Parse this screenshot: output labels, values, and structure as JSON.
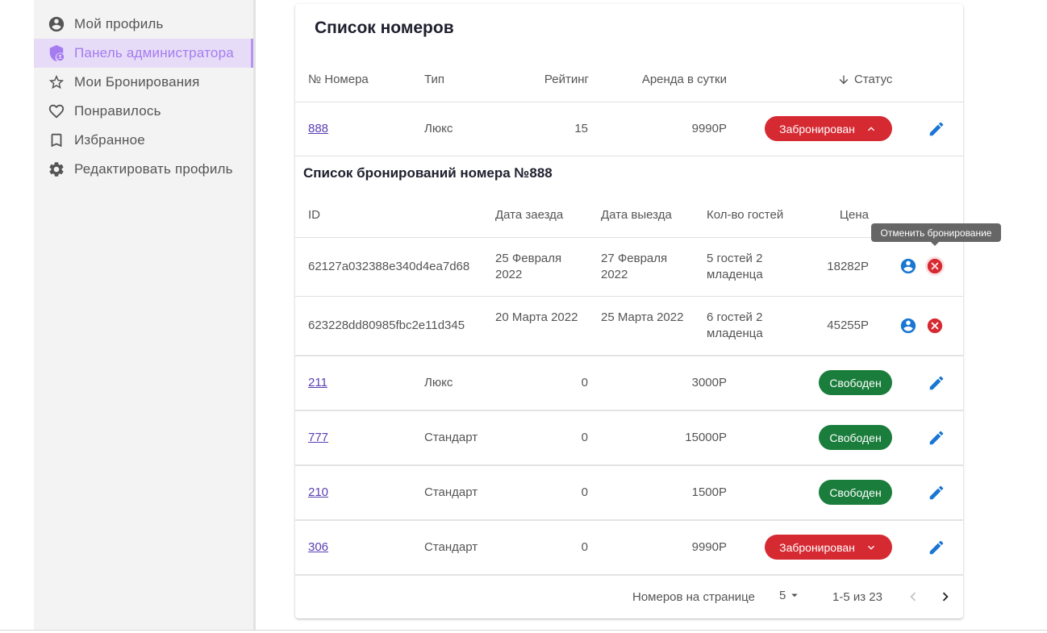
{
  "sidebar": {
    "items": [
      {
        "label": "Мой профиль",
        "icon": "account-circle-icon"
      },
      {
        "label": "Панель администратора",
        "icon": "admin-shield-icon",
        "active": true
      },
      {
        "label": "Мои Бронирования",
        "icon": "star-outline-icon"
      },
      {
        "label": "Понравилось",
        "icon": "heart-outline-icon"
      },
      {
        "label": "Избранное",
        "icon": "bookmark-outline-icon"
      },
      {
        "label": "Редактировать профиль",
        "icon": "gear-icon"
      }
    ]
  },
  "main": {
    "title": "Список номеров",
    "columns": {
      "number": "№ Номера",
      "type": "Тип",
      "rating": "Рейтинг",
      "rent": "Аренда в сутки",
      "status": "Статус"
    },
    "rows": [
      {
        "number": "888",
        "type": "Люкс",
        "rating": "15",
        "rent": "9990Р",
        "status": "Забронирован",
        "expanded": true
      },
      {
        "number": "211",
        "type": "Люкс",
        "rating": "0",
        "rent": "3000Р",
        "status": "Свободен"
      },
      {
        "number": "777",
        "type": "Стандарт",
        "rating": "0",
        "rent": "15000Р",
        "status": "Свободен"
      },
      {
        "number": "210",
        "type": "Стандарт",
        "rating": "0",
        "rent": "1500Р",
        "status": "Свободен"
      },
      {
        "number": "306",
        "type": "Стандарт",
        "rating": "0",
        "rent": "9990Р",
        "status": "Забронирован"
      }
    ],
    "bookings": {
      "title": "Список бронирований номера №888",
      "columns": {
        "id": "ID",
        "checkin": "Дата заезда",
        "checkout": "Дата выезда",
        "guests": "Кол-во гостей",
        "price": "Цена"
      },
      "rows": [
        {
          "id": "62127a032388e340d4ea7d68",
          "checkin": "25 Февраля 2022",
          "checkout": "27 Февраля 2022",
          "guests": "5 гостей 2 младенца",
          "price": "18282Р"
        },
        {
          "id": "623228dd80985fbc2e11d345",
          "checkin": "20 Марта 2022",
          "checkout": "25 Марта 2022",
          "guests": "6 гостей 2 младенца",
          "price": "45255Р"
        }
      ],
      "tooltip": "Отменить бронирование"
    },
    "pagination": {
      "per_page_label": "Номеров на странице",
      "per_page_value": "5",
      "range": "1-5 из 23"
    }
  },
  "colors": {
    "accent": "#a57cf0",
    "booked": "#d62a33",
    "free": "#1a7d3c",
    "action_blue": "#1976d2",
    "link": "#5b3fb3"
  }
}
